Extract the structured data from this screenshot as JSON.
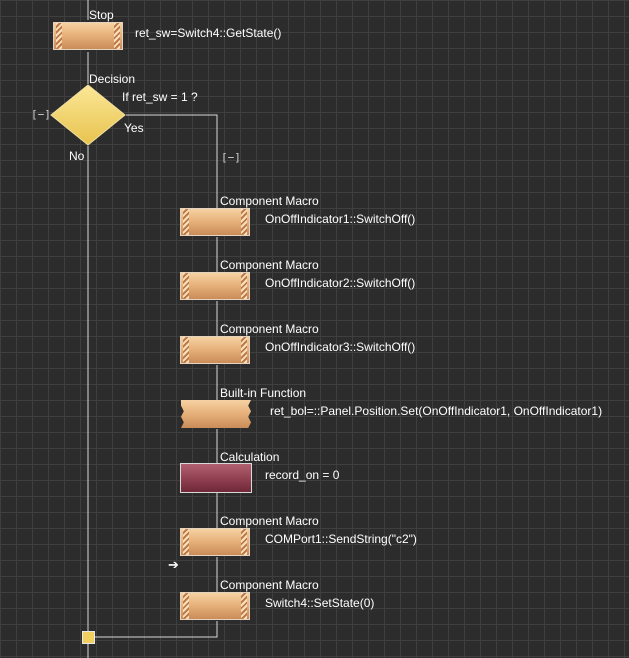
{
  "stop": {
    "title": "Stop",
    "text": "ret_sw=Switch4::GetState()"
  },
  "decision": {
    "title": "Decision",
    "condition": "If  ret_sw = 1 ?",
    "yes_label": "Yes",
    "no_label": "No",
    "collapse_left": "[−]",
    "collapse_right": "[−]"
  },
  "blocks": [
    {
      "type": "Component Macro",
      "text": "OnOffIndicator1::SwitchOff()"
    },
    {
      "type": "Component Macro",
      "text": "OnOffIndicator2::SwitchOff()"
    },
    {
      "type": "Component Macro",
      "text": "OnOffIndicator3::SwitchOff()"
    },
    {
      "type": "Built-in Function",
      "text": "ret_bol=::Panel.Position.Set(OnOffIndicator1, OnOffIndicator1)"
    },
    {
      "type": "Calculation",
      "text": "record_on = 0"
    },
    {
      "type": "Component Macro",
      "text": "COMPort1::SendString(\"c2\")"
    },
    {
      "type": "Component Macro",
      "text": "Switch4::SetState(0)"
    }
  ],
  "icons": {
    "diamond": "decision-diamond-icon",
    "cursor": "arrow-right-icon",
    "end": "end-node-icon"
  },
  "colors": {
    "background": "#2c2c2c",
    "grid": "#3f3f3f",
    "macro_block": "#e8b27c",
    "calc_block": "#8c3c4d",
    "decision": "#f3d66a",
    "line": "#d9d9d9"
  }
}
